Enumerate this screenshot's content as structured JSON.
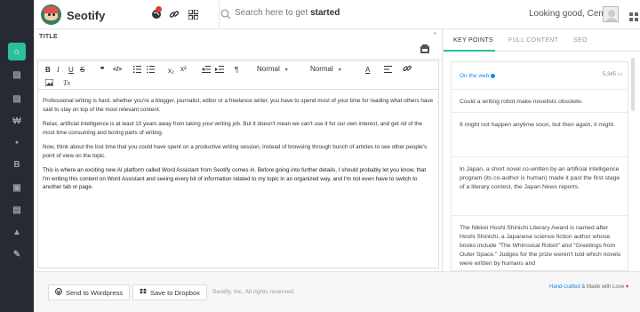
{
  "header": {
    "brand": "Seotify",
    "search_placeholder_prefix": "Search here to get ",
    "search_placeholder_bold": "started",
    "greeting": "Looking good, Cem"
  },
  "sidebar": {
    "items": [
      {
        "icon": "home-icon",
        "glyph": "⌂",
        "active": true
      },
      {
        "icon": "chart-icon",
        "glyph": "▤"
      },
      {
        "icon": "list-icon",
        "glyph": "▤"
      },
      {
        "icon": "won-icon",
        "glyph": "₩"
      },
      {
        "icon": "drop-icon",
        "glyph": "●"
      },
      {
        "icon": "bold-b-icon",
        "glyph": "B"
      },
      {
        "icon": "briefcase-icon",
        "glyph": "▣"
      },
      {
        "icon": "stack-icon",
        "glyph": "▤"
      },
      {
        "icon": "warning-icon",
        "glyph": "▲"
      },
      {
        "icon": "pin-icon",
        "glyph": "✎"
      }
    ]
  },
  "editor": {
    "title_label": "TITLE",
    "required_mark": "*",
    "toolbar": {
      "bold": "B",
      "italic": "I",
      "underline": "U",
      "strike": "S",
      "quote": "❞",
      "code": "</>",
      "sub": "x₂",
      "sup": "x²",
      "dir": "¶",
      "size_select": "Normal",
      "header_select": "Normal",
      "font_color": "A",
      "clear": "Tx"
    },
    "paragraphs": [
      "Professional writing is hard, whether you're a blogger, journalist, editor or a freelance writer, you have to spend most of your time for reading what others have said to stay on top of the most relevant content.",
      "Relax, artificial intelligence is at least 10 years away from taking your writing job. But it doesn't mean we can't use it for our own interest, and get rid of the most time consuming and boring parts of writing.",
      "Now, think about the lost time that you could have spent on a productive writing session, instead of browsing through bunch of articles to see other people's point of view on the topic.",
      "This is where an exciting new AI platform called Word Assistant from Seotify comes in. Before going into further details, I should probably let you know, that I'm writing this content on Word Assistant and seeing every bit of information related to my topic in an organized way, and I'm not even have to switch to another tab or page."
    ]
  },
  "right_panel": {
    "tabs": [
      "KEY POINTS",
      "FULL CONTENT",
      "SEO"
    ],
    "source_label": "On the web",
    "count": "5,345",
    "points": [
      "Could a writing robot make novelists obsolete.",
      "It might not happen anytime soon, but then again, it might.",
      "In Japan, a short novel co-written by an artificial intelligence program (its co-author is human) made it past the first stage of a literary contest, the Japan News reports.",
      "The Nikkei Hoshi Shinichi Literary Award is named after Hoshi Shinichi, a Japanese science fiction author whose books include \"The Whimsical Robot\" and \"Greetings from Outer Space.\" Judges for the prize weren't told which novels were written by humans and"
    ]
  },
  "footer": {
    "send_wordpress": "Send to Wordpress",
    "save_dropbox": "Save to Dropbox",
    "copyright": "Seotify, Inc. All rights reserved.",
    "handcrafted": "Hand-crafted",
    "made_with": "& Made with Love",
    "heart": "♥"
  },
  "colors": {
    "accent": "#2bbf9e",
    "sidebar_bg": "#262b33",
    "link": "#1e88e5",
    "alert": "#e53935"
  }
}
